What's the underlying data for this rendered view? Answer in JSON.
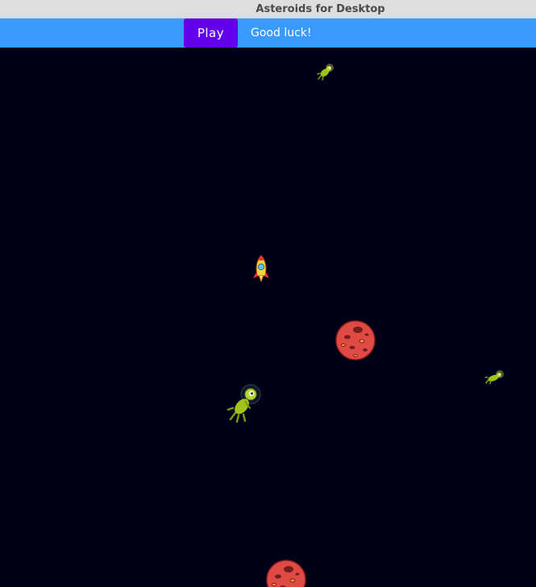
{
  "window": {
    "title": "Asteroids for Desktop"
  },
  "toolbar": {
    "play_label": "Play",
    "status_text": "Good luck!"
  },
  "colors": {
    "titlebar_bg": "#dedede",
    "toolbar_bg": "#3a9bff",
    "play_button_bg": "#6200ee",
    "space_bg": "#000018",
    "asteroid_red": "#e04a44",
    "alien_green": "#a4c21e"
  },
  "game": {
    "sprites": [
      {
        "kind": "player-ship",
        "icon": "rocket-icon"
      },
      {
        "kind": "asteroid",
        "icon": "red-planet-asteroid-icon"
      },
      {
        "kind": "asteroid",
        "icon": "red-planet-asteroid-icon"
      },
      {
        "kind": "alien",
        "icon": "green-alien-icon"
      },
      {
        "kind": "alien",
        "icon": "green-alien-small-icon"
      },
      {
        "kind": "alien",
        "icon": "green-alien-small-icon"
      }
    ]
  }
}
